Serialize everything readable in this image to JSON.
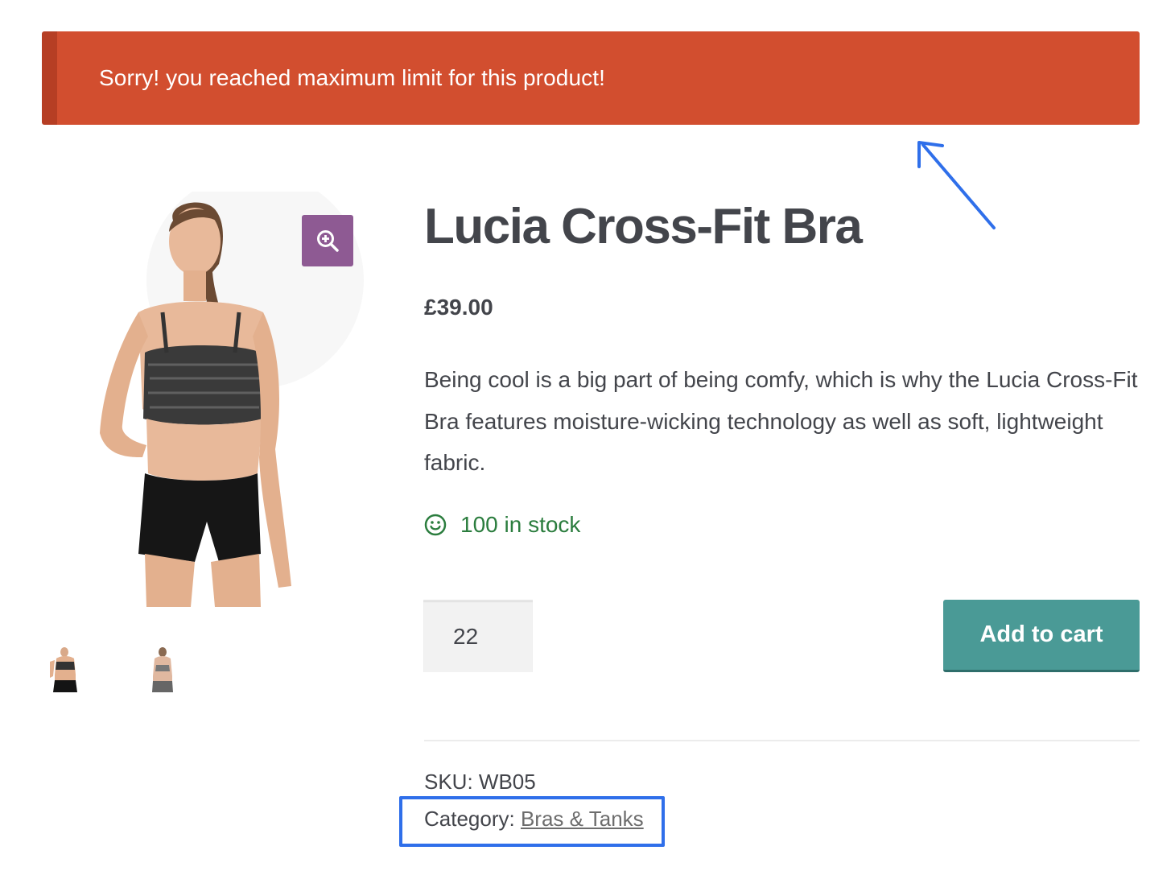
{
  "notice": {
    "message": "Sorry! you reached maximum limit for this product!",
    "background_color": "#d24e2f"
  },
  "gallery": {
    "zoom_icon": "zoom-in-icon",
    "thumbnails": [
      {
        "alt": "Front view"
      },
      {
        "alt": "Back view"
      }
    ]
  },
  "product": {
    "title": "Lucia Cross-Fit Bra",
    "price": "£39.00",
    "description": "Being cool is a big part of being comfy, which is why the Lucia Cross-Fit Bra features moisture-wicking technology as well as soft, lightweight fabric.",
    "stock": {
      "icon": "smile-icon",
      "text": "100 in stock",
      "color": "#2b7d3e"
    }
  },
  "cart": {
    "quantity": "22",
    "add_to_cart_label": "Add to cart",
    "button_color": "#4a9a96"
  },
  "meta": {
    "sku_label": "SKU:",
    "sku_value": "WB05",
    "category_label": "Category:",
    "category_value": "Bras & Tanks"
  },
  "annotations": {
    "arrow_color": "#2f6fea",
    "highlight_color": "#2f6fea"
  }
}
